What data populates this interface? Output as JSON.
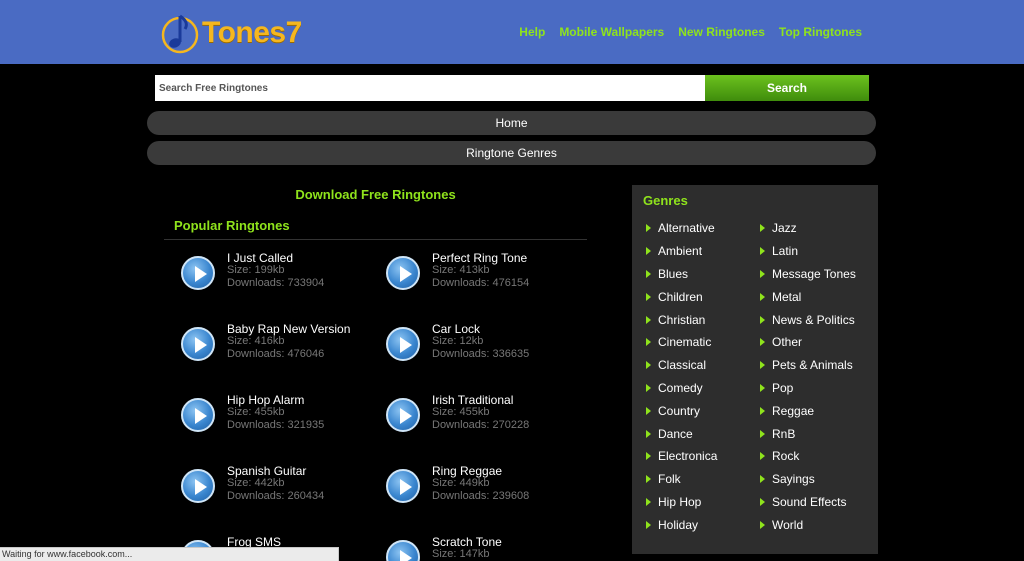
{
  "brand": {
    "name": "Tones7",
    "icon": "music-note-logo-icon"
  },
  "nav": [
    {
      "label": "Help"
    },
    {
      "label": "Mobile Wallpapers"
    },
    {
      "label": "New Ringtones"
    },
    {
      "label": "Top Ringtones"
    }
  ],
  "search": {
    "placeholder": "Search Free Ringtones",
    "button_label": "Search"
  },
  "menu": {
    "home": "Home",
    "ringtone_genres": "Ringtone Genres"
  },
  "main": {
    "download_title": "Download Free Ringtones",
    "popular_title": "Popular Ringtones",
    "ringtones": [
      {
        "name": "I Just Called",
        "size": "Size: 199kb",
        "downloads": "Downloads: 733904"
      },
      {
        "name": "Perfect Ring Tone",
        "size": "Size: 413kb",
        "downloads": "Downloads: 476154"
      },
      {
        "name": "Baby Rap New Version",
        "size": "Size: 416kb",
        "downloads": "Downloads: 476046"
      },
      {
        "name": "Car Lock",
        "size": "Size: 12kb",
        "downloads": "Downloads: 336635"
      },
      {
        "name": "Hip Hop Alarm",
        "size": "Size: 455kb",
        "downloads": "Downloads: 321935"
      },
      {
        "name": "Irish Traditional",
        "size": "Size: 455kb",
        "downloads": "Downloads: 270228"
      },
      {
        "name": "Spanish Guitar",
        "size": "Size: 442kb",
        "downloads": "Downloads: 260434"
      },
      {
        "name": "Ring Reggae",
        "size": "Size: 449kb",
        "downloads": "Downloads: 239608"
      },
      {
        "name": "Frog SMS",
        "size": "",
        "downloads": ""
      },
      {
        "name": "Scratch Tone",
        "size": "Size: 147kb",
        "downloads": ""
      }
    ]
  },
  "genres": {
    "title": "Genres",
    "col1": [
      "Alternative",
      "Ambient",
      "Blues",
      "Children",
      "Christian",
      "Cinematic",
      "Classical",
      "Comedy",
      "Country",
      "Dance",
      "Electronica",
      "Folk",
      "Hip Hop",
      "Holiday"
    ],
    "col2": [
      "Jazz",
      "Latin",
      "Message Tones",
      "Metal",
      "News & Politics",
      "Other",
      "Pets & Animals",
      "Pop",
      "Reggae",
      "RnB",
      "Rock",
      "Sayings",
      "Sound Effects",
      "World"
    ]
  },
  "status": {
    "text": "Waiting for www.facebook.com..."
  },
  "colors": {
    "header": "#4a6bc3",
    "accent_green": "#8fe31c",
    "logo_gold": "#f5b71f",
    "play_blue": "#3a86cf"
  }
}
